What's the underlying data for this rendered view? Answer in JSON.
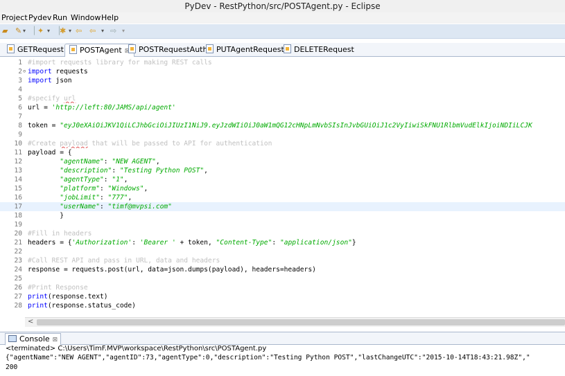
{
  "window": {
    "title": "PyDev - RestPython/src/POSTAgent.py - Eclipse"
  },
  "menu": [
    "Project",
    "Pydev",
    "Run",
    "Window",
    "Help"
  ],
  "toolbar": {
    "icons": [
      "open-folder-icon",
      "new-wizard-icon",
      "new-class-icon",
      "debug-config-icon",
      "navigate-back-icon",
      "navigate-forward-icon"
    ]
  },
  "tabs": [
    {
      "label": "GETRequest",
      "active": false
    },
    {
      "label": "POSTAgent",
      "active": true,
      "close": "⊠"
    },
    {
      "label": "POSTRequestAuth",
      "active": false
    },
    {
      "label": "PUTAgentRequest",
      "active": false
    },
    {
      "label": "DELETERequest",
      "active": false
    }
  ],
  "editor": {
    "fold_marker": "⊖",
    "lines": [
      {
        "n": "1",
        "tokens": [
          {
            "t": "#import requests library for making REST calls",
            "c": "cm"
          }
        ]
      },
      {
        "n": "2",
        "tokens": [
          {
            "t": "import",
            "c": "kw"
          },
          {
            "t": " requests",
            "c": "tx"
          }
        ]
      },
      {
        "n": "3",
        "tokens": [
          {
            "t": "import",
            "c": "kw"
          },
          {
            "t": " json",
            "c": "tx"
          }
        ]
      },
      {
        "n": "4",
        "tokens": []
      },
      {
        "n": "5",
        "tokens": [
          {
            "t": "#specify ",
            "c": "cm"
          },
          {
            "t": "url",
            "c": "cm sp"
          }
        ]
      },
      {
        "n": "6",
        "tokens": [
          {
            "t": "url = ",
            "c": "tx"
          },
          {
            "t": "'http://left:80/JAMS/api/agent'",
            "c": "st"
          }
        ]
      },
      {
        "n": "7",
        "tokens": []
      },
      {
        "n": "8",
        "tokens": [
          {
            "t": "token = ",
            "c": "tx"
          },
          {
            "t": "\"eyJ0eXAiOiJKV1QiLCJhbGciOiJIUzI1NiJ9.eyJzdWIiOiJ0aW1mQG12cHNpLmNvbSIsInJvbGUiOiJ1c2VyIiwiSkFNU1RlbmVudElkIjoiNDIiLCJK",
            "c": "st"
          }
        ]
      },
      {
        "n": "9",
        "tokens": []
      },
      {
        "n": "10",
        "tokens": [
          {
            "t": "#Create ",
            "c": "cm"
          },
          {
            "t": "payload",
            "c": "cm sp"
          },
          {
            "t": " that will be passed to API for authentication",
            "c": "cm"
          }
        ]
      },
      {
        "n": "11",
        "tokens": [
          {
            "t": "payload = {",
            "c": "tx"
          }
        ]
      },
      {
        "n": "12",
        "tokens": [
          {
            "t": "        ",
            "c": "tx"
          },
          {
            "t": "\"agentName\"",
            "c": "st"
          },
          {
            "t": ": ",
            "c": "tx"
          },
          {
            "t": "\"NEW AGENT\"",
            "c": "st"
          },
          {
            "t": ",",
            "c": "tx"
          }
        ]
      },
      {
        "n": "13",
        "tokens": [
          {
            "t": "        ",
            "c": "tx"
          },
          {
            "t": "\"description\"",
            "c": "st"
          },
          {
            "t": ": ",
            "c": "tx"
          },
          {
            "t": "\"Testing Python POST\"",
            "c": "st"
          },
          {
            "t": ",",
            "c": "tx"
          }
        ]
      },
      {
        "n": "14",
        "tokens": [
          {
            "t": "        ",
            "c": "tx"
          },
          {
            "t": "\"agentType\"",
            "c": "st"
          },
          {
            "t": ": ",
            "c": "tx"
          },
          {
            "t": "\"1\"",
            "c": "st"
          },
          {
            "t": ",",
            "c": "tx"
          }
        ]
      },
      {
        "n": "15",
        "tokens": [
          {
            "t": "        ",
            "c": "tx"
          },
          {
            "t": "\"platform\"",
            "c": "st"
          },
          {
            "t": ": ",
            "c": "tx"
          },
          {
            "t": "\"Windows\"",
            "c": "st"
          },
          {
            "t": ",",
            "c": "tx"
          }
        ]
      },
      {
        "n": "16",
        "tokens": [
          {
            "t": "        ",
            "c": "tx"
          },
          {
            "t": "\"jobLimit\"",
            "c": "st"
          },
          {
            "t": ": ",
            "c": "tx"
          },
          {
            "t": "\"777\"",
            "c": "st"
          },
          {
            "t": ",",
            "c": "tx"
          }
        ]
      },
      {
        "n": "17",
        "current": true,
        "tokens": [
          {
            "t": "        ",
            "c": "tx"
          },
          {
            "t": "\"userName\"",
            "c": "st"
          },
          {
            "t": ": ",
            "c": "tx"
          },
          {
            "t": "\"timf@mvpsi.com\"",
            "c": "st"
          }
        ]
      },
      {
        "n": "18",
        "tokens": [
          {
            "t": "        }",
            "c": "tx"
          }
        ]
      },
      {
        "n": "19",
        "tokens": []
      },
      {
        "n": "20",
        "tokens": [
          {
            "t": "#Fill in headers",
            "c": "cm"
          }
        ]
      },
      {
        "n": "21",
        "tokens": [
          {
            "t": "headers = {",
            "c": "tx"
          },
          {
            "t": "'Authorization'",
            "c": "st"
          },
          {
            "t": ": ",
            "c": "tx"
          },
          {
            "t": "'Bearer '",
            "c": "st"
          },
          {
            "t": " + token, ",
            "c": "tx"
          },
          {
            "t": "\"Content-Type\"",
            "c": "st"
          },
          {
            "t": ": ",
            "c": "tx"
          },
          {
            "t": "\"application/json\"",
            "c": "st"
          },
          {
            "t": "}",
            "c": "tx"
          }
        ]
      },
      {
        "n": "22",
        "tokens": []
      },
      {
        "n": "23",
        "tokens": [
          {
            "t": "#Call REST API and pass in URL, data and headers",
            "c": "cm"
          }
        ]
      },
      {
        "n": "24",
        "tokens": [
          {
            "t": "response = requests.post(url, data=json.dumps(payload), headers=headers)",
            "c": "tx"
          }
        ]
      },
      {
        "n": "25",
        "tokens": []
      },
      {
        "n": "26",
        "tokens": [
          {
            "t": "#Print Response",
            "c": "cm"
          }
        ]
      },
      {
        "n": "27",
        "tokens": [
          {
            "t": "print",
            "c": "kw"
          },
          {
            "t": "(response.text)",
            "c": "tx"
          }
        ]
      },
      {
        "n": "28",
        "tokens": [
          {
            "t": "print",
            "c": "kw"
          },
          {
            "t": "(response.status_code)",
            "c": "tx"
          }
        ]
      }
    ]
  },
  "scrollbar": {
    "left_arrow": "<"
  },
  "console": {
    "tab_label": "Console",
    "close": "⊠",
    "status": "<terminated> C:\\Users\\TimF.MVP\\workspace\\RestPython\\src\\POSTAgent.py",
    "output": [
      "{\"agentName\":\"NEW AGENT\",\"agentID\":73,\"agentType\":0,\"description\":\"Testing Python POST\",\"lastChangeUTC\":\"2015-10-14T18:43:21.98Z\",\"",
      "200"
    ]
  },
  "colors": {
    "toolbar_bg": "#dde7f3",
    "keyword": "#0000ff",
    "string": "#00aa00",
    "comment": "#c0c0c0",
    "current_line": "#e8f2fe"
  }
}
